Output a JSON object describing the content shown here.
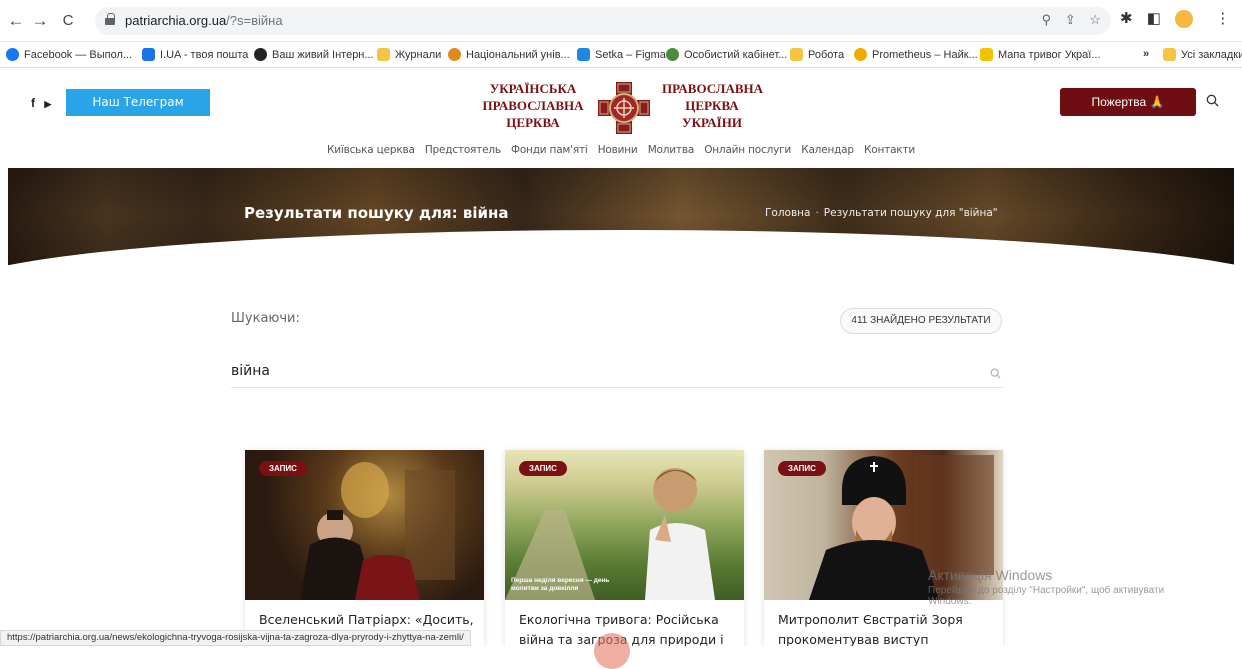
{
  "browser": {
    "url_host": "patriarchia.org.ua",
    "url_path": "/?s=війна",
    "back": "←",
    "forward": "→",
    "reload": "C",
    "bookmarks": [
      {
        "label": "Facebook — Выпол...",
        "color": "#1877f2"
      },
      {
        "label": "I.UA - твоя пошта",
        "color": "#1a73e8"
      },
      {
        "label": "Ваш живий Інтерн...",
        "color": "#222222"
      },
      {
        "label": "Журнали",
        "color": "#f4c542"
      },
      {
        "label": "Національний унів...",
        "color": "#e08a1e"
      },
      {
        "label": "Setka – Figma",
        "color": "#1e88e5"
      },
      {
        "label": "Особистий кабінет...",
        "color": "#4a8c3a"
      },
      {
        "label": "Робота",
        "color": "#f4c542"
      },
      {
        "label": "Prometheus – Найк...",
        "color": "#f2a900"
      },
      {
        "label": "Мапа тривог Украї...",
        "color": "#f2c200"
      },
      {
        "label": "»",
        "color": ""
      },
      {
        "label": "Усі закладки",
        "color": "#f4c542"
      }
    ],
    "status_url": "https://patriarchia.org.ua/news/ekologichna-tryvoga-rosijska-vijna-ta-zagroza-dlya-pryrody-i-zhyttya-na-zemli/"
  },
  "header": {
    "social_fb": "f",
    "social_yt": "▶",
    "telegram_label": "Наш Телеграм",
    "logo_left": [
      "УКРАЇНСЬКА",
      "ПРАВОСЛАВНА",
      "ЦЕРКВА"
    ],
    "logo_right": [
      "ПРАВОСЛАВНА",
      "ЦЕРКВА",
      "УКРАЇНИ"
    ],
    "donate_label": "Пожертва 🙏",
    "menu": [
      "Київська церква",
      "Предстоятель",
      "Фонди пам'яті",
      "Новини",
      "Молитва",
      "Онлайн послуги",
      "Календар",
      "Контакти"
    ]
  },
  "hero": {
    "title": "Результати пошуку для: війна",
    "crumb_home": "Головна",
    "crumb_current": "Результати пошуку для \"війна\""
  },
  "search": {
    "label": "Шукаючи:",
    "count": "411 ЗНАЙДЕНО РЕЗУЛЬТАТИ",
    "query": "війна"
  },
  "cards": [
    {
      "badge": "ЗАПИС",
      "title": "Вселенський Патріарх: «Досить,"
    },
    {
      "badge": "ЗАПИС",
      "title": "Екологічна тривога: Російська війна та загроза для природи і",
      "overlay": "Перша неділя вересня — день молитви за довкілля"
    },
    {
      "badge": "ЗАПИС",
      "title": "Митрополит Євстратій Зоря прокоментував виступ"
    }
  ],
  "windows_watermark": {
    "line1": "Активація Windows",
    "line2": "Перейдіть до розділу \"Настройки\", щоб активувати",
    "line3": "Windows."
  }
}
